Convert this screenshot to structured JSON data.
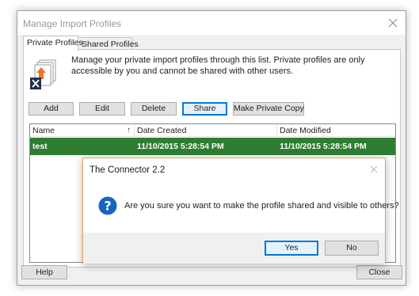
{
  "window": {
    "title": "Manage Import Profiles",
    "tabs": [
      {
        "label": "Private Profiles",
        "active": true
      },
      {
        "label": "Shared Profiles",
        "active": false
      }
    ],
    "info_text": "Manage your private import profiles through this list. Private profiles are only accessible by you and cannot be shared with other users.",
    "buttons": {
      "add": "Add",
      "edit": "Edit",
      "delete": "Delete",
      "share": "Share",
      "make_private_copy": "Make Private Copy"
    },
    "list": {
      "columns": [
        "Name",
        "Date Created",
        "Date Modified"
      ],
      "sort_indicator": "↑",
      "rows": [
        {
          "name": "test",
          "date_created": "11/10/2015 5:28:54 PM",
          "date_modified": "11/10/2015 5:28:54 PM",
          "selected": true
        }
      ]
    },
    "footer": {
      "help": "Help",
      "close": "Close"
    }
  },
  "dialog": {
    "title": "The Connector 2.2",
    "icon": "question-icon",
    "message": "Are you sure you want to make the profile shared and visible to others?",
    "yes": "Yes",
    "no": "No"
  },
  "colors": {
    "selected_row": "#2e7d32",
    "dialog_border": "#e8a44a",
    "focus_accent": "#0078d7",
    "question_icon": "#1565c0"
  }
}
